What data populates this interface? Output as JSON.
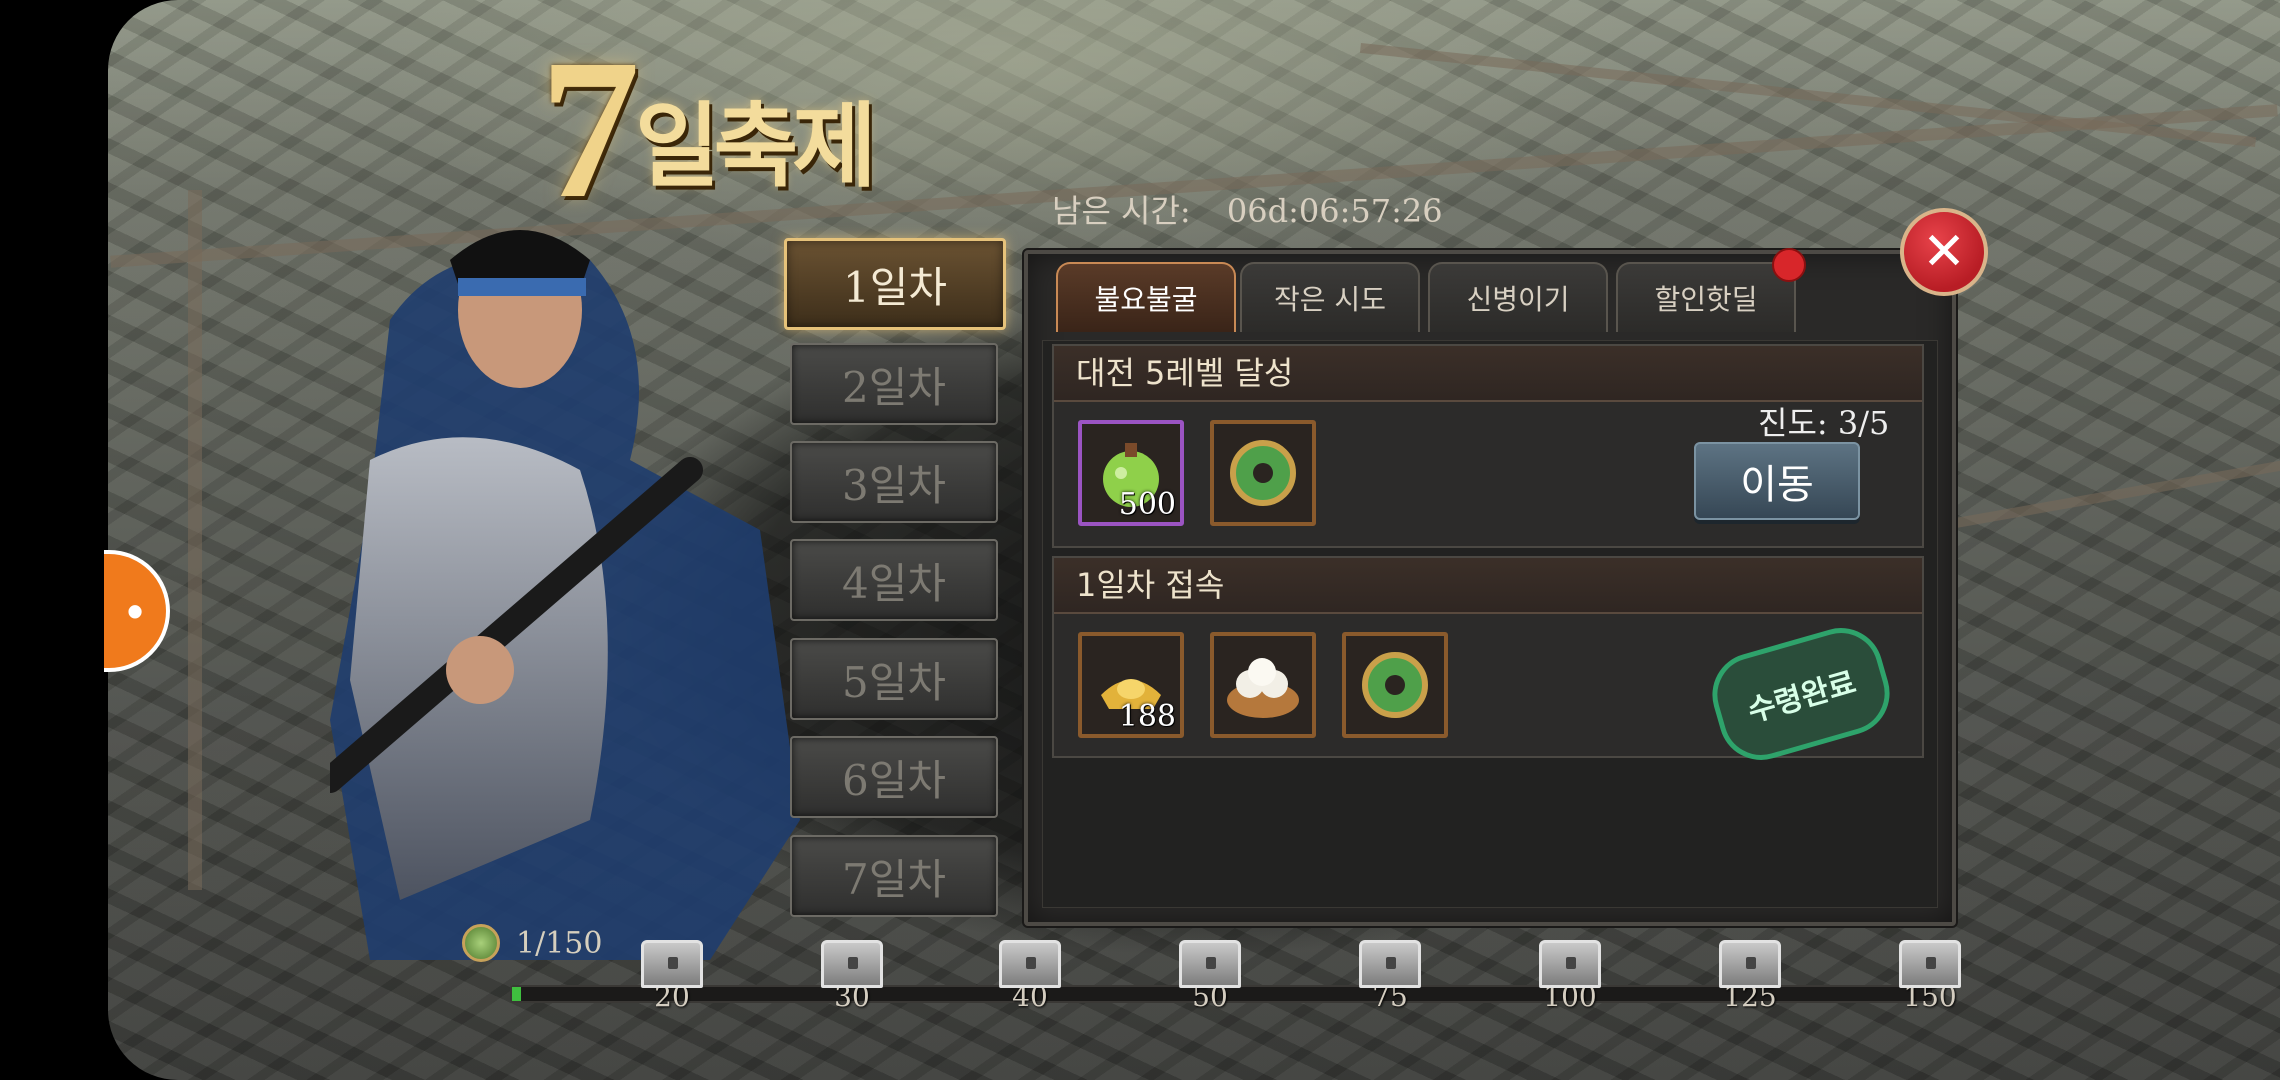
{
  "event": {
    "title_number": "7",
    "title_word": "일축제",
    "timer_label": "남은 시간:",
    "timer_value": "06d:06:57:26"
  },
  "days": [
    {
      "label": "1일차",
      "active": true
    },
    {
      "label": "2일차",
      "active": false
    },
    {
      "label": "3일차",
      "active": false
    },
    {
      "label": "4일차",
      "active": false
    },
    {
      "label": "5일차",
      "active": false
    },
    {
      "label": "6일차",
      "active": false
    },
    {
      "label": "7일차",
      "active": false
    }
  ],
  "sub_tabs": [
    {
      "label": "불요불굴",
      "active": true
    },
    {
      "label": "작은 시도",
      "active": false
    },
    {
      "label": "신병이기",
      "active": false
    },
    {
      "label": "할인핫딜",
      "active": false,
      "notification": true
    }
  ],
  "missions": [
    {
      "title": "대전 5레벨 달성",
      "progress_label": "진도: 3/5",
      "rewards": [
        {
          "icon": "jade-pouch-icon",
          "qty": "500"
        },
        {
          "icon": "jade-coin-icon",
          "qty": ""
        }
      ],
      "action_label": "이동"
    },
    {
      "title": "1일차 접속",
      "rewards": [
        {
          "icon": "gold-ingot-icon",
          "qty": "188"
        },
        {
          "icon": "steamed-buns-icon",
          "qty": ""
        },
        {
          "icon": "jade-coin-icon",
          "qty": ""
        }
      ],
      "claimed_label": "수령완료"
    }
  ],
  "points": {
    "value_label": "1/150",
    "current": 1,
    "max": 150,
    "milestones": [
      "20",
      "30",
      "40",
      "50",
      "75",
      "100",
      "125",
      "150"
    ]
  },
  "colors": {
    "accent_gold": "#e6c27a",
    "close_red": "#c8262e",
    "move_button": "#4a5f6e",
    "claimed_green": "#2ea36b",
    "progress_green": "#3fbf3f"
  }
}
